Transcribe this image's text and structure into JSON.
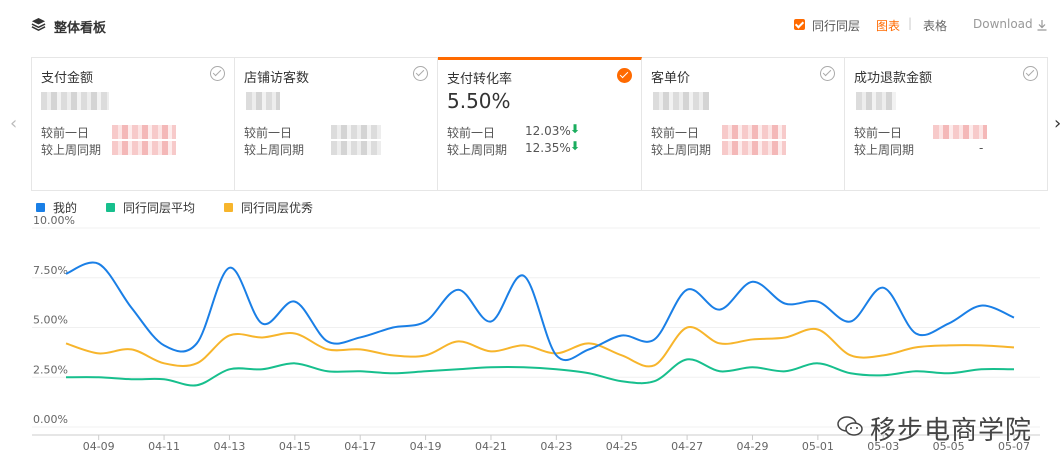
{
  "header": {
    "title": "整体看板",
    "peer_label": "同行同层",
    "view_chart": "图表",
    "view_separator": "|",
    "view_table": "表格",
    "download": "Download",
    "accent_color": "#ff6a00"
  },
  "nav": {
    "prev_arrow": "‹",
    "next_arrow": "›"
  },
  "cards": [
    {
      "title": "支付金额",
      "value": "",
      "day_label": "较前一日",
      "week_label": "较上周同期",
      "day_value": "",
      "week_value": "",
      "checked": false
    },
    {
      "title": "店铺访客数",
      "value": "",
      "day_label": "较前一日",
      "week_label": "较上周同期",
      "day_value": "",
      "week_value": "",
      "checked": false
    },
    {
      "title": "支付转化率",
      "value": "5.50%",
      "day_label": "较前一日",
      "week_label": "较上周同期",
      "day_value": "12.03%",
      "week_value": "12.35%",
      "checked": true
    },
    {
      "title": "客单价",
      "value": "",
      "day_label": "较前一日",
      "week_label": "较上周同期",
      "day_value": "",
      "week_value": "",
      "checked": false
    },
    {
      "title": "成功退款金额",
      "value": "",
      "day_label": "较前一日",
      "week_label": "较上周同期",
      "day_value": "",
      "week_value": "-",
      "checked": false
    }
  ],
  "legend": [
    {
      "name": "我的",
      "color": "#1a7fe6"
    },
    {
      "name": "同行同层平均",
      "color": "#17bf8d"
    },
    {
      "name": "同行同层优秀",
      "color": "#f7b52c"
    }
  ],
  "watermark": "移步电商学院",
  "chart_data": {
    "type": "line",
    "ylim": [
      0,
      10
    ],
    "yticks": [
      "10.00%",
      "7.50%",
      "5.00%",
      "2.50%",
      "0.00%"
    ],
    "xlabels": [
      "04-09",
      "04-11",
      "04-13",
      "04-15",
      "04-17",
      "04-19",
      "04-21",
      "04-23",
      "04-25",
      "04-27",
      "04-29",
      "05-01",
      "05-03",
      "05-05",
      "05-07"
    ],
    "x_start_day": 8,
    "series": [
      {
        "name": "我的",
        "color": "#1a7fe6",
        "values": [
          7.7,
          8.2,
          6.0,
          4.1,
          4.2,
          8.0,
          5.2,
          6.3,
          4.3,
          4.5,
          5.0,
          5.3,
          6.9,
          5.3,
          7.6,
          3.6,
          3.9,
          4.6,
          4.4,
          6.9,
          5.9,
          7.3,
          6.2,
          6.3,
          5.3,
          7.0,
          4.7,
          5.2,
          6.1,
          5.5
        ]
      },
      {
        "name": "同行同层平均",
        "color": "#17bf8d",
        "values": [
          2.5,
          2.5,
          2.4,
          2.4,
          2.1,
          2.9,
          2.9,
          3.2,
          2.8,
          2.8,
          2.7,
          2.8,
          2.9,
          3.0,
          3.0,
          2.9,
          2.7,
          2.3,
          2.3,
          3.4,
          2.8,
          3.0,
          2.8,
          3.2,
          2.7,
          2.6,
          2.8,
          2.7,
          2.9,
          2.9
        ]
      },
      {
        "name": "同行同层优秀",
        "color": "#f7b52c",
        "values": [
          4.2,
          3.7,
          3.9,
          3.2,
          3.2,
          4.6,
          4.5,
          4.7,
          3.9,
          3.9,
          3.6,
          3.6,
          4.3,
          3.8,
          4.1,
          3.7,
          4.2,
          3.6,
          3.1,
          5.0,
          4.2,
          4.4,
          4.5,
          4.9,
          3.6,
          3.6,
          4.0,
          4.1,
          4.1,
          4.0
        ]
      }
    ]
  }
}
